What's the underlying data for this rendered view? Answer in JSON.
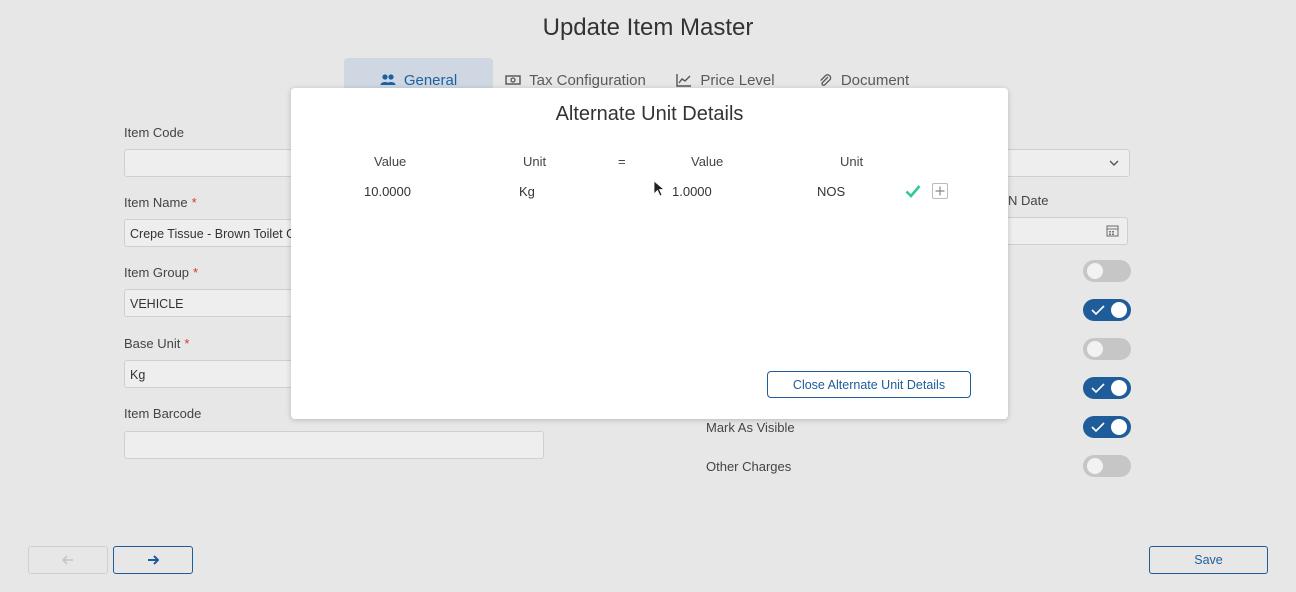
{
  "page": {
    "title": "Update Item Master"
  },
  "tabs": [
    {
      "label": "General",
      "icon": "users-icon",
      "active": true
    },
    {
      "label": "Tax Configuration",
      "icon": "money-icon",
      "active": false
    },
    {
      "label": "Price Level",
      "icon": "chart-icon",
      "active": false
    },
    {
      "label": "Document",
      "icon": "paperclip-icon",
      "active": false
    }
  ],
  "form": {
    "item_code": {
      "label": "Item Code",
      "value": ""
    },
    "item_name": {
      "label": "Item Name",
      "required_mark": "*",
      "value": "Crepe Tissue - Brown Toilet Gr"
    },
    "item_group": {
      "label": "Item Group",
      "required_mark": "*",
      "value": "VEHICLE"
    },
    "base_unit": {
      "label": "Base Unit",
      "required_mark": "*",
      "value": "Kg"
    },
    "item_barcode": {
      "label": "Item Barcode",
      "value": ""
    }
  },
  "right_panel": {
    "date_label_partial": "N Date",
    "mark_as_visible_label": "Mark As Visible",
    "other_charges_label": "Other Charges",
    "toggles": [
      false,
      true,
      false,
      true,
      true,
      false
    ]
  },
  "modal": {
    "title": "Alternate Unit Details",
    "headers": {
      "value1": "Value",
      "unit1": "Unit",
      "equals": "=",
      "value2": "Value",
      "unit2": "Unit"
    },
    "row": {
      "value1": "10.0000",
      "unit1": "Kg",
      "value2": "1.0000",
      "unit2": "NOS"
    },
    "close_button": "Close Alternate Unit Details"
  },
  "footer": {
    "save_label": "Save"
  },
  "colors": {
    "accent": "#1e5d99",
    "check": "#2ecc8f",
    "required": "#dd3333"
  }
}
